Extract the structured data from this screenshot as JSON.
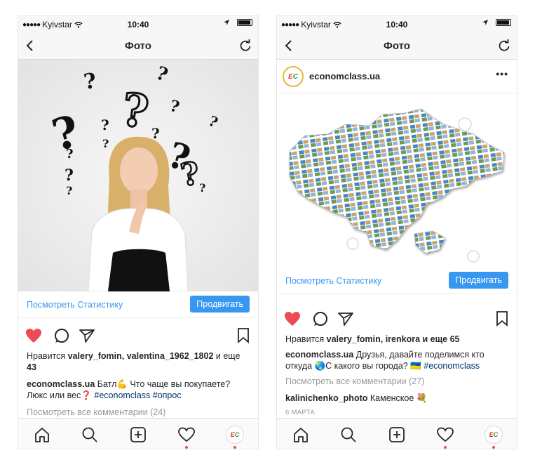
{
  "status": {
    "carrier": "Kyivstar",
    "time": "10:40"
  },
  "nav": {
    "title": "Фото"
  },
  "left_post": {
    "stats_link": "Посмотреть Статистику",
    "promote_button": "Продвигать",
    "likes_prefix": "Нравится ",
    "likes_users": "valery_fomin, valentina_1962_1802",
    "likes_suffix": " и еще",
    "likes_count": "43",
    "caption_user": "economclass.ua",
    "caption_text_1": " Батл💪 Что чаще вы покупаете?",
    "caption_text_2": "Люкс или вес❓ ",
    "caption_tags": "#economclass #опрос",
    "view_comments": "Посмотреть все комментарии (24)"
  },
  "right_post": {
    "account_name": "economclass.ua",
    "stats_link": "Посмотреть Статистику",
    "promote_button": "Продвигать",
    "likes_prefix": "Нравится ",
    "likes_users": "valery_fomin, irenkora",
    "likes_suffix": " и еще 65",
    "caption_user": "economclass.ua",
    "caption_text_1": " Друзья, давайте поделимся кто",
    "caption_text_2": "откуда 🌏С какого вы города? 🇺🇦 ",
    "caption_tags": "#economclass",
    "view_comments": "Посмотреть все комментарии (27)",
    "comment_user": "kalinichenko_photo",
    "comment_text": " Каменское 💐",
    "date": "6 МАРТА"
  },
  "avatar": {
    "letter1": "E",
    "letter2": "C"
  },
  "icons": {
    "back": "chevron-left-icon",
    "refresh": "refresh-icon",
    "like": "heart-filled-icon",
    "comment": "comment-bubble-icon",
    "share": "paper-plane-icon",
    "bookmark": "bookmark-icon",
    "home": "home-icon",
    "search": "search-icon",
    "add": "plus-square-icon",
    "activity": "heart-outline-icon"
  },
  "colors": {
    "link_blue": "#3897f0",
    "like_red": "#ed4956",
    "hashtag": "#003569",
    "muted": "#999999"
  }
}
